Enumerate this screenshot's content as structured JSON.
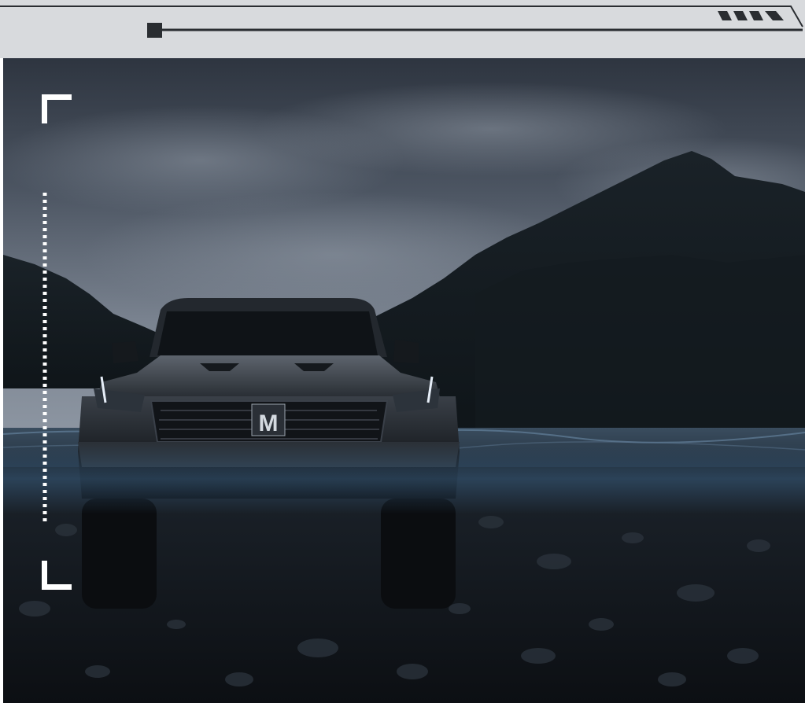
{
  "topbar": {
    "progress_fraction": 0.02,
    "stripe_count": 4,
    "bar_color": "#2a2d31",
    "background_color": "#d8dadd"
  },
  "scene": {
    "sky_color": "#6b7480",
    "mountain_color": "#1d262d",
    "water_color": "#2c3d4e",
    "ground_color": "#151a20",
    "vehicle_color": "#1b1f24",
    "badge_text": "M"
  },
  "overlay": {
    "bracket_color": "#ffffff",
    "dotted_line_color": "#ffffff"
  }
}
